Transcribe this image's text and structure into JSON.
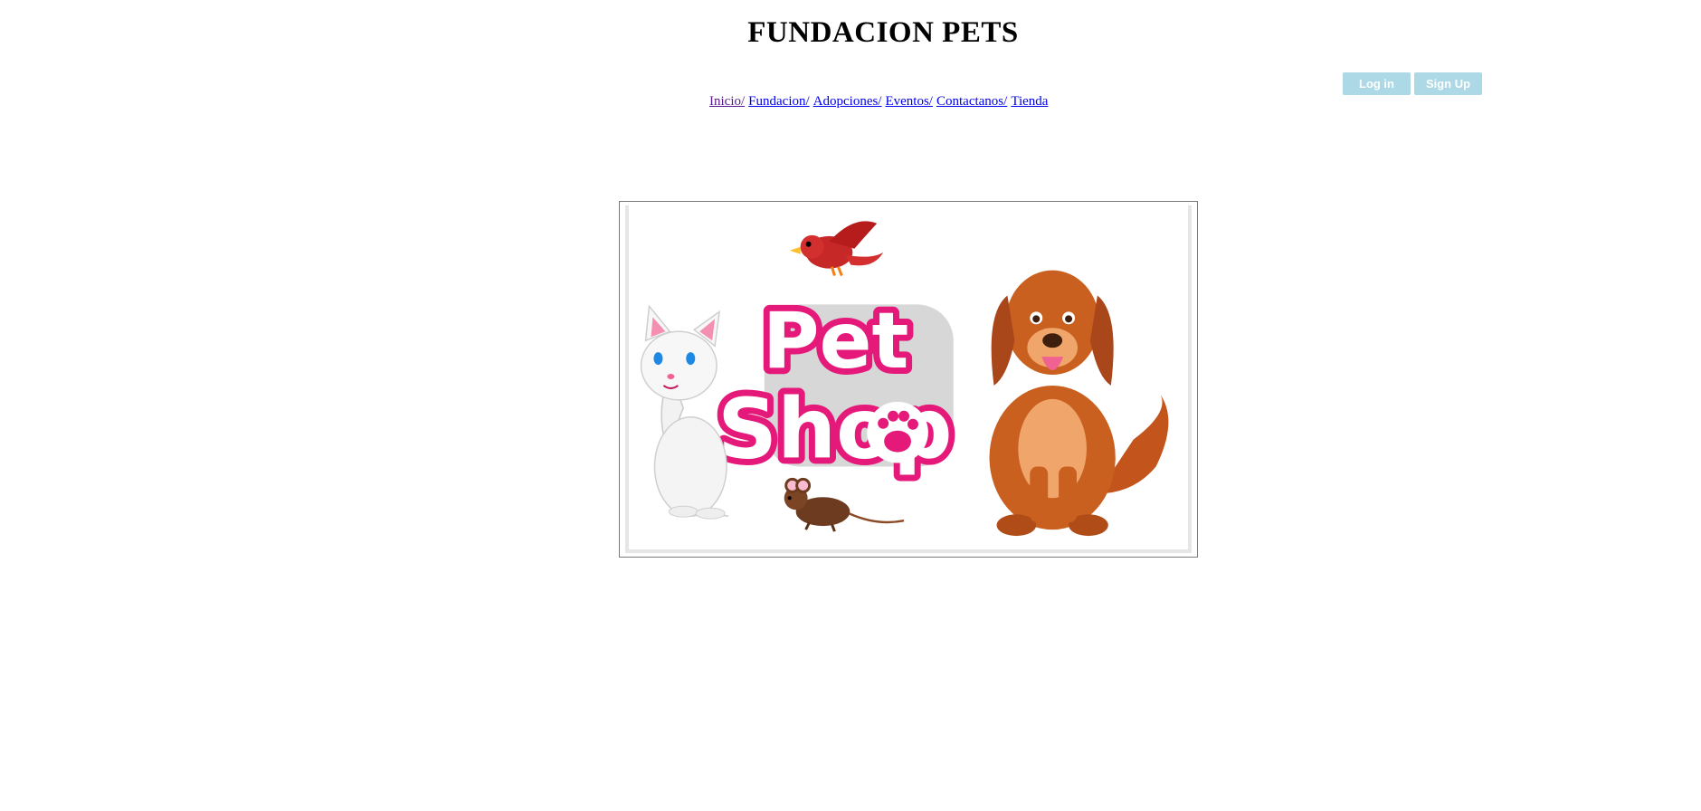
{
  "header": {
    "title": "FUNDACION PETS"
  },
  "auth": {
    "login_label": "Log in",
    "signup_label": "Sign Up",
    "button_color": "#add8e6"
  },
  "nav": {
    "items": [
      {
        "label": "Inicio/",
        "visited": true
      },
      {
        "label": "Fundacion/",
        "visited": false
      },
      {
        "label": "Adopciones/",
        "visited": false
      },
      {
        "label": "Eventos/",
        "visited": false
      },
      {
        "label": "Contactanos/",
        "visited": false
      },
      {
        "label": "Tienda",
        "visited": false
      }
    ],
    "link_color": "#0000ee",
    "visited_color": "#551a8b"
  },
  "hero": {
    "logo_text_line1": "Pet",
    "logo_text_line2": "Shop",
    "brand_color": "#e5197a",
    "icons": [
      "bird-icon",
      "cat-icon",
      "dog-icon",
      "mouse-icon",
      "paw-icon"
    ]
  }
}
